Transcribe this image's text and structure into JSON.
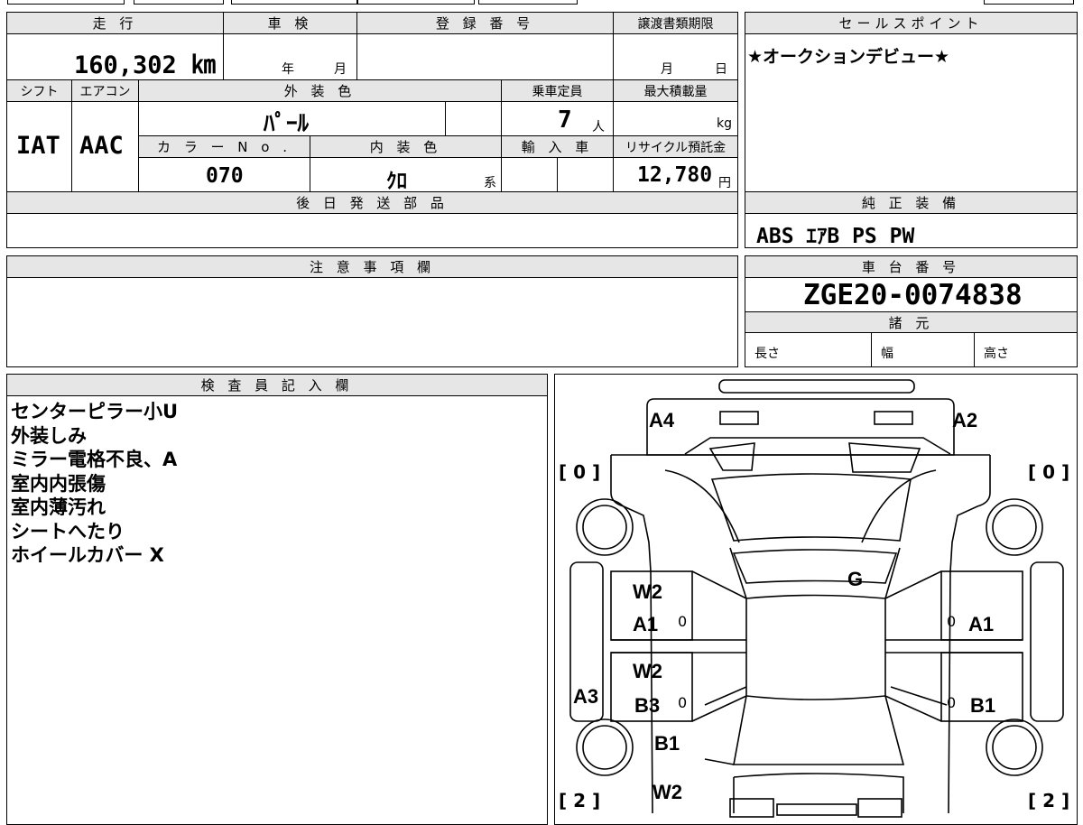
{
  "vehicle": {
    "mileage_label": "走 行",
    "mileage_value": "160,302 ㎞",
    "inspection_label": "車 検",
    "inspection_year": "年",
    "inspection_month": "月",
    "registration_label": "登 録 番 号",
    "transfer_label": "譲渡書類期限",
    "transfer_month": "月",
    "transfer_day": "日",
    "shift_label": "シフト",
    "shift_value": "IAT",
    "ac_label": "エアコン",
    "ac_value": "AAC",
    "exterior_label": "外 装 色",
    "exterior_value": "ﾊﾟｰﾙ",
    "capacity_label": "乗車定員",
    "capacity_value": "7",
    "capacity_unit": "人",
    "load_label": "最大積載量",
    "load_unit": "kg",
    "color_no_label": "カ ラ ー N o .",
    "color_no_value": "070",
    "interior_label": "内 装 色",
    "interior_value": "ｸﾛ",
    "interior_suffix": "系",
    "import_label": "輸 入 車",
    "recycle_label": "リサイクル預託金",
    "recycle_value": "12,780",
    "recycle_unit": "円",
    "later_parts_label": "後 日 発 送 部 品"
  },
  "sales": {
    "label": "セールスポイント",
    "text": "★オークションデビュー★"
  },
  "equipment": {
    "label": "純 正 装 備",
    "value": "ABS ｴｱB PS PW"
  },
  "caution": {
    "label": "注 意 事 項 欄"
  },
  "chassis": {
    "label": "車 台 番 号",
    "value": "ZGE20-0074838",
    "spec_label": "諸 元",
    "length_label": "長さ",
    "width_label": "幅",
    "height_label": "高さ"
  },
  "inspector": {
    "label": "検 査 員 記 入 欄",
    "notes": [
      "センターピラー小U",
      "外装しみ",
      "ミラー電格不良、A",
      "室内内張傷",
      "室内薄汚れ",
      "シートへたり",
      "ホイールカバー X"
    ]
  },
  "diagram": {
    "a4": "A4",
    "a2": "A2",
    "tire_fl": "[ 0 ]",
    "tire_fr": "[ 0 ]",
    "tire_rl": "[ 2 ]",
    "tire_rr": "[ 2 ]",
    "g": "G",
    "left_front_w2": "W2",
    "left_front_a1": "A1",
    "left_front_zero": "0",
    "left_rear_w2": "W2",
    "left_rear_b3": "B3",
    "left_rear_zero": "0",
    "a3": "A3",
    "b1_bottom": "B1",
    "w2_bottom": "W2",
    "right_front_zero": "0",
    "right_front_a1": "A1",
    "right_rear_zero": "0",
    "right_rear_b1": "B1"
  }
}
